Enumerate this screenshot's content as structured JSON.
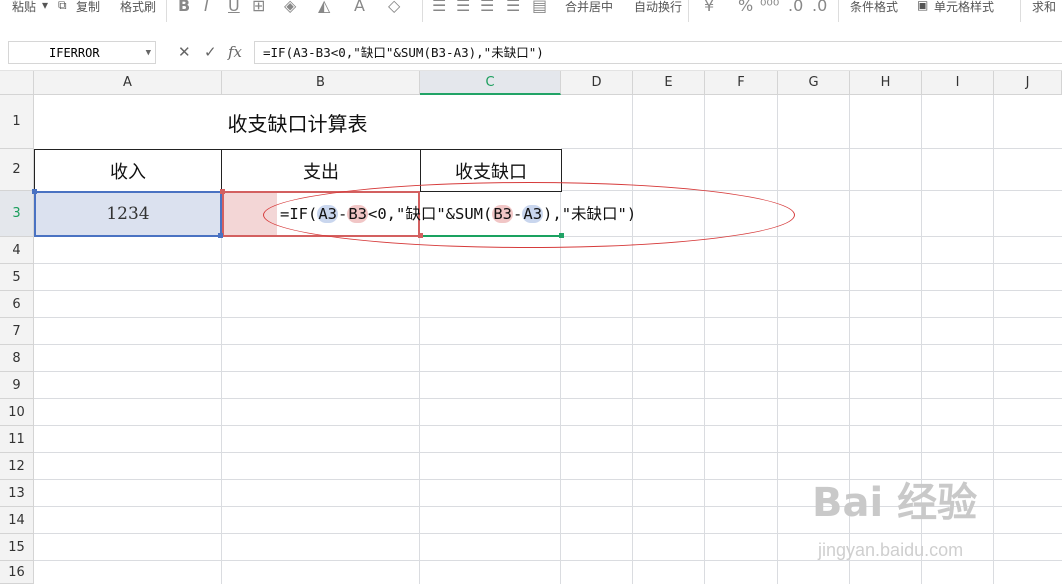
{
  "toolbar": {
    "paste": "粘贴",
    "copy": "复制",
    "format_painter": "格式刷",
    "merge_center": "合并居中",
    "wrap_text": "自动换行",
    "conditional_format": "条件格式",
    "cell_style": "单元格样式",
    "sum": "求和"
  },
  "formula_bar": {
    "name_box": "IFERROR",
    "cancel_icon": "✕",
    "confirm_icon": "✓",
    "fx_label": "fx",
    "formula": "=IF(A3-B3<0,\"缺口\"&SUM(B3-A3),\"未缺口\")"
  },
  "columns": [
    "A",
    "B",
    "C",
    "D",
    "E",
    "F",
    "G",
    "H",
    "I",
    "J"
  ],
  "rows": [
    "1",
    "2",
    "3",
    "4",
    "5",
    "6",
    "7",
    "8",
    "9",
    "10",
    "11",
    "12",
    "13",
    "14",
    "15",
    "16"
  ],
  "sheet": {
    "title": "收支缺口计算表",
    "header_income": "收入",
    "header_expense": "支出",
    "header_gap": "收支缺口",
    "a3_value": "1234"
  },
  "edit_formula": {
    "p1": "=IF(",
    "r1": "A3",
    "p2": "-",
    "r2": "B3",
    "p3": "<0,\"缺口\"&SUM(",
    "r3": "B3",
    "p4": "-",
    "r4": "A3",
    "p5": "),\"未缺口\")"
  },
  "watermark": {
    "text": "Bai 经验",
    "url": "jingyan.baidu.com"
  },
  "colors": {
    "selection_green": "#21a366",
    "ref_blue": "#4a72c2",
    "ref_red": "#d36060",
    "annotation_red": "#d63b3b"
  }
}
